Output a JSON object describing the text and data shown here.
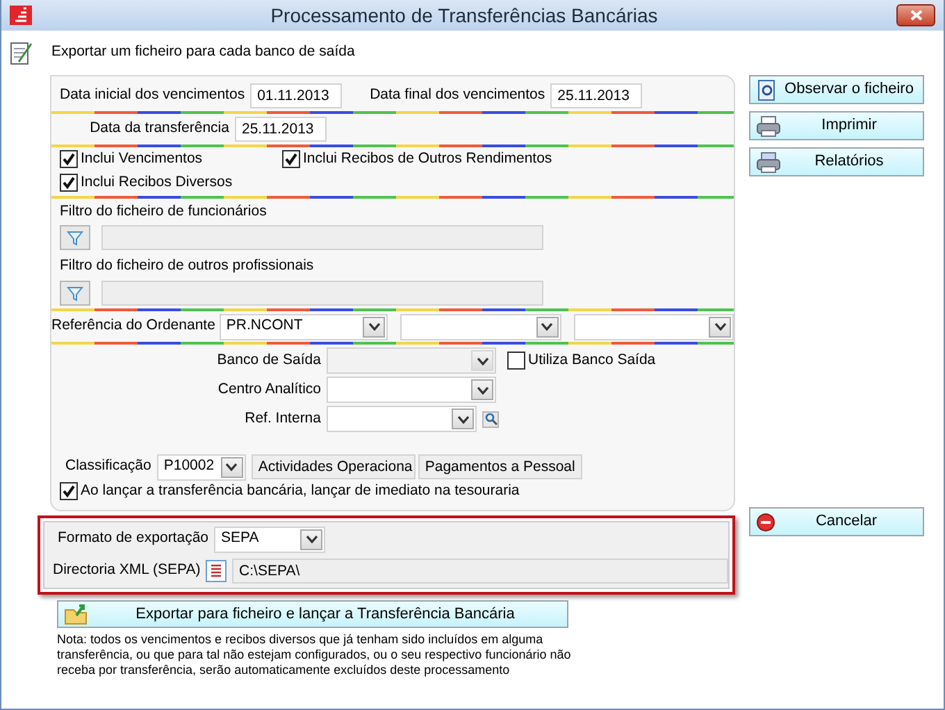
{
  "window": {
    "title": "Processamento de Transferências Bancárias"
  },
  "header": {
    "text": "Exportar um ficheiro para cada banco de saída"
  },
  "dates": [
    {
      "label": "Data inicial dos vencimentos",
      "value": "01.11.2013"
    },
    {
      "label": "Data final dos vencimentos",
      "value": "25.11.2013"
    },
    {
      "label": "Data da transferência",
      "value": "25.11.2013"
    }
  ],
  "includes": [
    {
      "label": "Inclui Vencimentos",
      "checked": true
    },
    {
      "label": "Inclui Recibos de Outros Rendimentos",
      "checked": true
    },
    {
      "label": "Inclui Recibos Diversos",
      "checked": true
    }
  ],
  "filters": [
    {
      "label": "Filtro do ficheiro de funcionários"
    },
    {
      "label": "Filtro do ficheiro de outros profissionais"
    }
  ],
  "ordenante": {
    "label": "Referência do Ordenante",
    "combos": [
      {
        "kind": "combo",
        "value": "PR.NCONT"
      },
      {
        "kind": "combo"
      },
      {
        "kind": "combo"
      }
    ]
  },
  "bank_fields": [
    {
      "kind": "combo",
      "label": "Banco de Saída",
      "disabled": true
    },
    {
      "kind": "combo",
      "label": "Centro Analítico",
      "disabled": false
    },
    {
      "kind": "lookup",
      "label": "Ref. Interna",
      "disabled": false
    }
  ],
  "use_bank": {
    "label": "Utiliza Banco Saída",
    "checked": false
  },
  "classification": {
    "label": "Classificação",
    "code": "P10002",
    "group": "Actividades Operaciona",
    "description": "Pagamentos a Pessoal"
  },
  "treasury": {
    "label": "Ao lançar a transferência bancária, lançar de imediato na tesouraria",
    "checked": true
  },
  "export": {
    "highlighted": true,
    "format_label": "Formato de exportação",
    "format": "SEPA",
    "dir_label": "Directoria XML (SEPA)",
    "dir": "C:\\SEPA\\"
  },
  "export_button": {
    "label": "Exportar para ficheiro e lançar a Transferência Bancária"
  },
  "note": "Nota: todos os vencimentos e recibos diversos que já tenham sido incluídos em alguma transferência, ou que para tal não estejam configurados, ou o seu respectivo funcionário não receba por transferência, serão automaticamente excluídos deste processamento",
  "side_buttons": [
    {
      "kind": "view",
      "label": "Observar o ficheiro"
    },
    {
      "kind": "print",
      "label": "Imprimir"
    },
    {
      "kind": "reports",
      "label": "Relatórios"
    }
  ],
  "cancel_button": {
    "label": "Cancelar"
  }
}
